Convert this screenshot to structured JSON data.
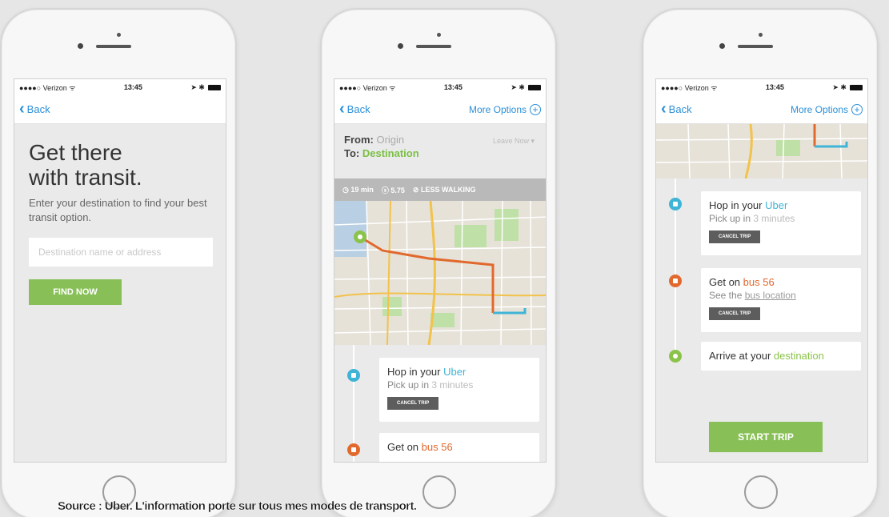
{
  "status": {
    "carrier": "●●●●○ Verizon ᯤ",
    "time": "13:45",
    "icons": "➤ ✱"
  },
  "nav": {
    "back": "Back",
    "more": "More Options",
    "plus": "+"
  },
  "phone1": {
    "title_line1": "Get there",
    "title_line2": "with transit.",
    "subtitle": "Enter your destination to find your best transit option.",
    "placeholder": "Destination name or address",
    "button": "FIND NOW"
  },
  "phone2": {
    "from_label": "From:",
    "from_value": "Origin",
    "to_label": "To:",
    "to_value": "Destination",
    "leave": "Leave Now ▾",
    "trip_time": "◷ 19 min",
    "trip_cost": "ⓢ 5.75",
    "trip_mode": "⊘ LESS WALKING"
  },
  "steps": {
    "hop_prefix": "Hop in your ",
    "hop_brand": "Uber",
    "pickup_prefix": "Pick up in ",
    "pickup_value": "3 minutes",
    "cancel": "CANCEL TRIP",
    "bus_prefix": "Get on ",
    "bus_value": "bus 56",
    "see_prefix": "See the ",
    "see_link": "bus location",
    "arrive_prefix": "Arrive at your ",
    "arrive_value": "destination"
  },
  "phone3": {
    "button": "START TRIP"
  },
  "caption": "Source : Uber. L'information porte sur tous mes modes de transport.",
  "colors": {
    "accent_blue": "#2a8fd8",
    "uber": "#3fb4d6",
    "bus": "#e2692e",
    "green": "#88c057"
  }
}
